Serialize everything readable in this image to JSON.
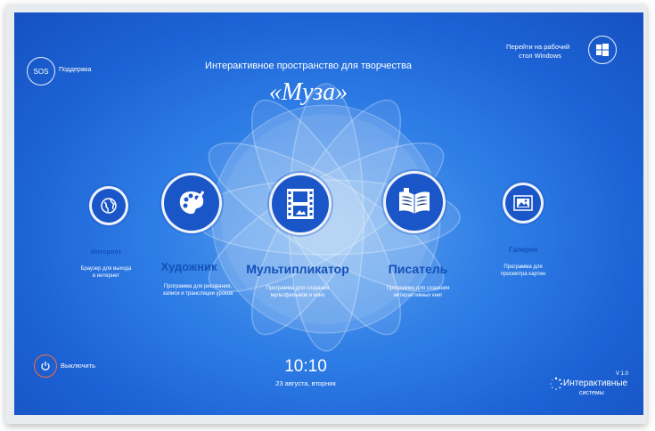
{
  "header": {
    "subtitle": "Интерактивное пространство для творчества",
    "title": "«Муза»"
  },
  "support": {
    "sos_label": "SOS",
    "label": "Поддержка"
  },
  "windows": {
    "line1": "Перейти на рабочий",
    "line2": "стол Windows"
  },
  "apps": [
    {
      "title": "Интернет",
      "desc": "Браузер для выхода в интернет",
      "icon": "globe-icon"
    },
    {
      "title": "Художник",
      "desc": "Программа для рисования, записи и трансляции уроков",
      "icon": "palette-icon"
    },
    {
      "title": "Мультипликатор",
      "desc": "Программа для создания мультфильмов и кино",
      "icon": "film-icon"
    },
    {
      "title": "Писатель",
      "desc": "Программа для создания интерактивных книг",
      "icon": "book-icon"
    },
    {
      "title": "Галерея",
      "desc": "Программа для просмотра картин",
      "icon": "gallery-icon"
    }
  ],
  "power": {
    "label": "Выключить"
  },
  "clock": {
    "time": "10:10",
    "date": "23 августа, вторник"
  },
  "brand": {
    "version": "V 1.0",
    "line1": "Интерактивные",
    "line2": "системы"
  }
}
